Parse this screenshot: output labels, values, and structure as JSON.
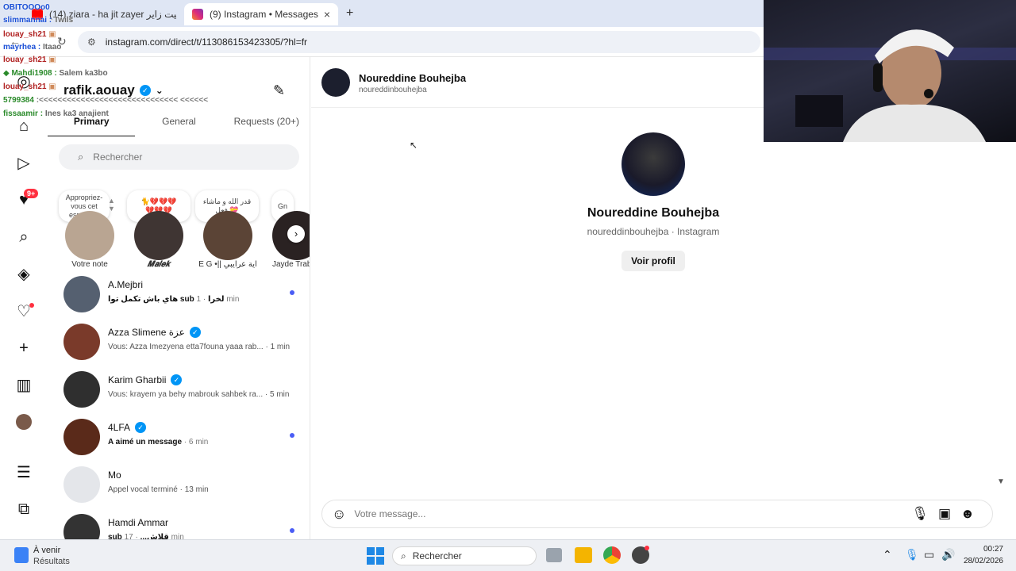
{
  "browser": {
    "tab1_title": "(14) ziara - ha jit zayer حبيت زاير",
    "tab2_title": "(9) Instagram • Messages",
    "tab_close": "×",
    "new_tab": "+",
    "url": "instagram.com/direct/t/113086153423305/?hl=fr"
  },
  "chat_overlay": [
    {
      "user": "OBITOOOo0",
      "msg": ""
    },
    {
      "user": "slimmannai",
      "msg": "Twils"
    },
    {
      "user": "louay_sh21",
      "msg": ""
    },
    {
      "user": "mayrhea",
      "msg": "Itaao"
    },
    {
      "user": "louay_sh21",
      "msg": ""
    },
    {
      "user": "Mahdi1908",
      "msg": "Salem ka3bo"
    },
    {
      "user": "louay_sh21",
      "msg": ""
    },
    {
      "user": "5799384",
      "msg": ":<<<<<<<<<<<<<<<<<<<<<<<<<<<<<< <<<<<<"
    },
    {
      "user": "fissaamir",
      "msg": "Ines ka3 anajient"
    }
  ],
  "sidebar": {
    "notifications_badge": "9+"
  },
  "inbox": {
    "account_name": "rafik.aouay",
    "verified_mark": "✓",
    "tabs": [
      "Primary",
      "General",
      "Requests (20+)"
    ],
    "search_placeholder": "Rechercher",
    "notes": [
      "Appropriez-vous cet espace…",
      "🐈💔💔💔\n💔💔💔",
      "قدر الله و ماشاء فعل 💝",
      "Gn"
    ],
    "stories": [
      "Votre note",
      "𝑴𝒂𝒍𝒆𝒌",
      "E G •|| آية عرايبي",
      "Jayde Trabel"
    ],
    "conversations": [
      {
        "name": "A.Mejbri",
        "verified": false,
        "preview": "هاي باش تكمل توا sub لخرا",
        "time": "· 1 min",
        "unread": true
      },
      {
        "name": "Azza Slimene عزة",
        "verified": true,
        "preview": "Vous: Azza Imezyena etta7founa yaaa rab...",
        "time": "· 1 min",
        "unread": false
      },
      {
        "name": "Karim Gharbii",
        "verified": true,
        "preview": "Vous: krayem ya behy mabrouk sahbek ra...",
        "time": "· 5 min",
        "unread": false
      },
      {
        "name": "4LFA",
        "verified": true,
        "preview": "A aimé un message",
        "time": "· 6 min",
        "unread": true
      },
      {
        "name": "Mo",
        "verified": false,
        "preview": "Appel vocal terminé",
        "time": "· 13 min",
        "unread": false
      },
      {
        "name": "Hamdi Ammar",
        "verified": false,
        "preview": "sub قلاش...",
        "time": "· 17 min",
        "unread": true
      }
    ]
  },
  "thread": {
    "header_name": "Noureddine Bouhejba",
    "header_handle": "noureddinbouhejba",
    "profile_name": "Noureddine Bouhejba",
    "profile_sub": "noureddinbouhejba · Instagram",
    "view_profile": "Voir profil",
    "composer_placeholder": "Votre message..."
  },
  "taskbar": {
    "weather_title": "À venir",
    "weather_sub": "Résultats",
    "search": "Rechercher",
    "time": "00:27",
    "date": "28/02/2026"
  },
  "colors": {
    "accent": "#0095f6",
    "unread_dot": "#4a5df5",
    "badge": "#ff3040"
  }
}
